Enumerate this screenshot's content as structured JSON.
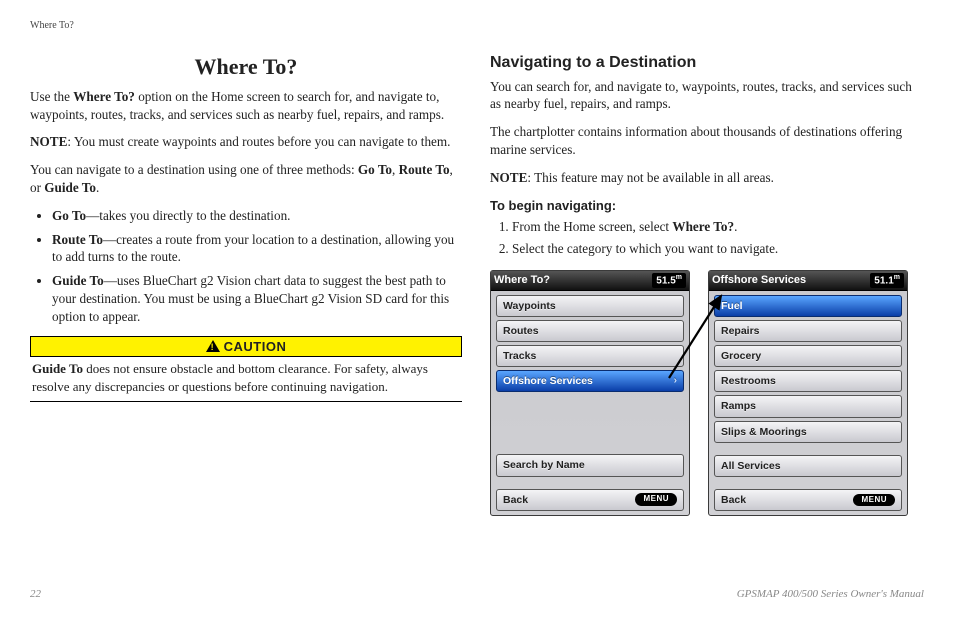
{
  "running_header": "Where To?",
  "left": {
    "title": "Where To?",
    "p1_a": "Use the ",
    "p1_bold": "Where To?",
    "p1_b": " option on the Home screen to search for, and navigate to, waypoints, routes, tracks, and services such as nearby fuel, repairs, and ramps.",
    "note_label": "NOTE",
    "p2": ": You must create waypoints and routes before you can navigate to them.",
    "p3_a": "You can navigate to a destination using one of three methods: ",
    "p3_go": "Go To",
    "p3_sep1": ", ",
    "p3_route": "Route To",
    "p3_sep2": ", or ",
    "p3_guide": "Guide To",
    "p3_end": ".",
    "bul1_t": "Go To",
    "bul1_b": "—takes you directly to the destination.",
    "bul2_t": "Route To",
    "bul2_b": "—creates a route from your location to a destination, allowing you to add turns to the route.",
    "bul3_t": "Guide To",
    "bul3_b": "—uses BlueChart g2 Vision chart data to suggest the best path to your destination. You must be using a BlueChart g2 Vision SD card for this option to appear.",
    "caution_label": "CAUTION",
    "caution_body_t": "Guide To",
    "caution_body_b": " does not ensure obstacle and bottom clearance. For safety, always resolve any discrepancies or questions before continuing navigation."
  },
  "right": {
    "title": "Navigating to a Destination",
    "p1": "You can search for, and navigate to, waypoints, routes, tracks, and services such as nearby fuel, repairs, and ramps.",
    "p2": "The chartplotter contains information about thousands of destinations offering marine services.",
    "note_label": "NOTE",
    "p3": ": This feature may not be available in all areas.",
    "sub": "To begin navigating:",
    "s1_a": "From the Home screen, select ",
    "s1_b": "Where To?",
    "s1_c": ".",
    "s2": "Select the category to which you want to navigate."
  },
  "screens": {
    "left": {
      "title": "Where To?",
      "depth": "51.5",
      "i_waypoints": "Waypoints",
      "i_routes": "Routes",
      "i_tracks": "Tracks",
      "i_offshore": "Offshore Services",
      "i_search": "Search by Name",
      "i_back": "Back",
      "menu": "MENU"
    },
    "right": {
      "title": "Offshore Services",
      "depth": "51.1",
      "i_fuel": "Fuel",
      "i_repairs": "Repairs",
      "i_grocery": "Grocery",
      "i_restrooms": "Restrooms",
      "i_ramps": "Ramps",
      "i_slips": "Slips & Moorings",
      "i_all": "All Services",
      "i_back": "Back",
      "menu": "MENU"
    }
  },
  "footer": {
    "page": "22",
    "manual": "GPSMAP 400/500 Series Owner's Manual"
  }
}
